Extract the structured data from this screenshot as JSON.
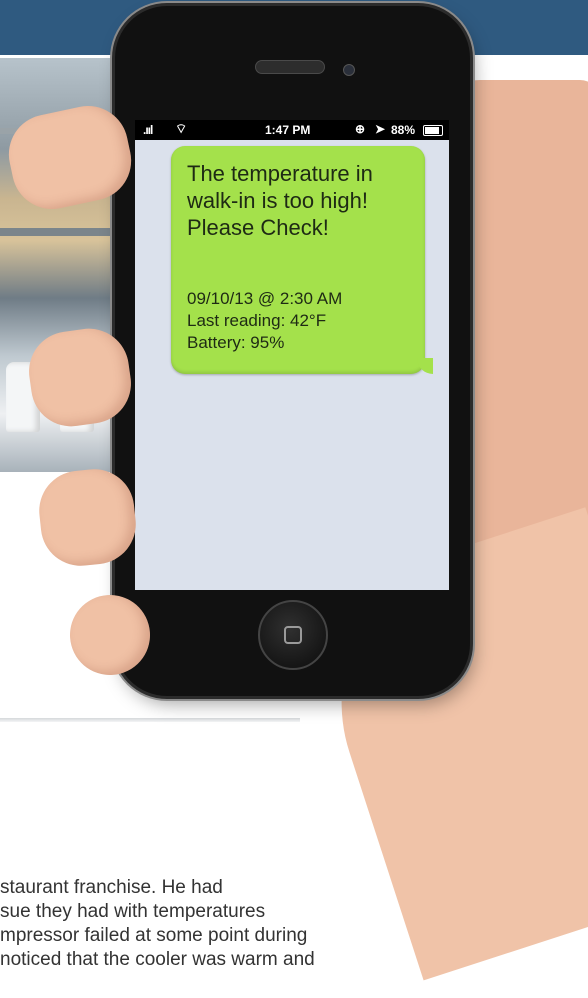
{
  "phone": {
    "status": {
      "time": "1:47 PM",
      "battery": "88%",
      "icons": [
        "signal-icon",
        "wifi-icon",
        "rotation-lock-icon",
        "location-icon",
        "battery-icon"
      ]
    },
    "message": {
      "headline_lines": [
        "The temperature in",
        "walk-in is too high!",
        "Please Check!"
      ],
      "date": "09/10/13 @ 2:30 AM",
      "reading": "Last reading: 42°F",
      "battery": "Battery: 95%",
      "bubble_color": "#a4e14b"
    }
  },
  "article": {
    "lines": [
      "staurant franchise. He had",
      "sue they had with temperatures",
      "mpressor failed at some point during",
      "noticed that the cooler was warm and"
    ]
  },
  "colors": {
    "header": "#2f5a80",
    "screen_bg": "#dbe1ec"
  }
}
